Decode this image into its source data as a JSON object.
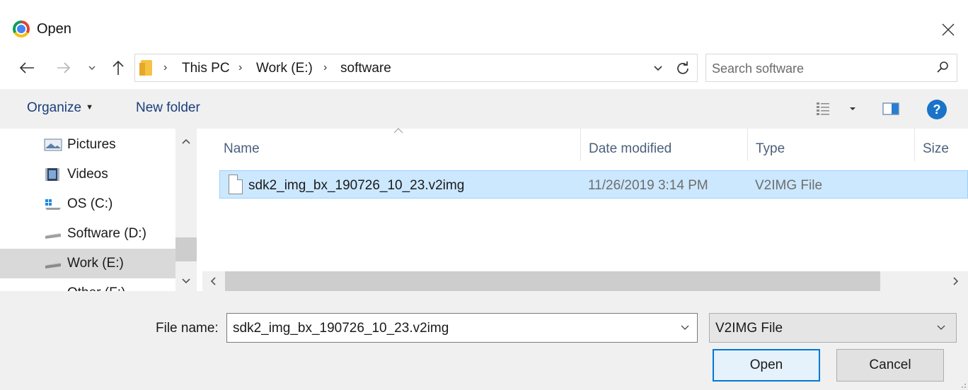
{
  "window": {
    "title": "Open",
    "close_glyph": "✕",
    "app_icon": "chrome-icon"
  },
  "nav": {
    "back_glyph": "←",
    "forward_glyph": "→",
    "recent_glyph": "⌄",
    "up_glyph": "↑"
  },
  "address": {
    "breadcrumbs": [
      "This PC",
      "Work (E:)",
      "software"
    ],
    "separator": "›"
  },
  "search": {
    "placeholder": "Search software"
  },
  "toolbar": {
    "organize_label": "Organize",
    "organize_caret": "▼",
    "new_folder_label": "New folder",
    "help_label": "?"
  },
  "nav_pane": {
    "items": [
      {
        "label": "Pictures",
        "icon": "pictures-icon"
      },
      {
        "label": "Videos",
        "icon": "videos-icon"
      },
      {
        "label": "OS (C:)",
        "icon": "os-drive-icon"
      },
      {
        "label": "Software (D:)",
        "icon": "drive-icon"
      },
      {
        "label": "Work (E:)",
        "icon": "drive-icon",
        "selected": true
      },
      {
        "label": "Other (F:)",
        "icon": "drive-icon"
      }
    ]
  },
  "file_list": {
    "columns": [
      "Name",
      "Date modified",
      "Type",
      "Size"
    ],
    "rows": [
      {
        "name": "sdk2_img_bx_190726_10_23.v2img",
        "date": "11/26/2019 3:14 PM",
        "type": "V2IMG File",
        "selected": true
      }
    ]
  },
  "bottom": {
    "file_name_label": "File name:",
    "file_name_value": "sdk2_img_bx_190726_10_23.v2img",
    "file_type_value": "V2IMG File",
    "open_label": "Open",
    "cancel_label": "Cancel"
  },
  "colors": {
    "selection_bg": "#cce8ff",
    "selection_border": "#99d1ff",
    "accent": "#0078d7",
    "link_text": "#1a3e7a"
  }
}
